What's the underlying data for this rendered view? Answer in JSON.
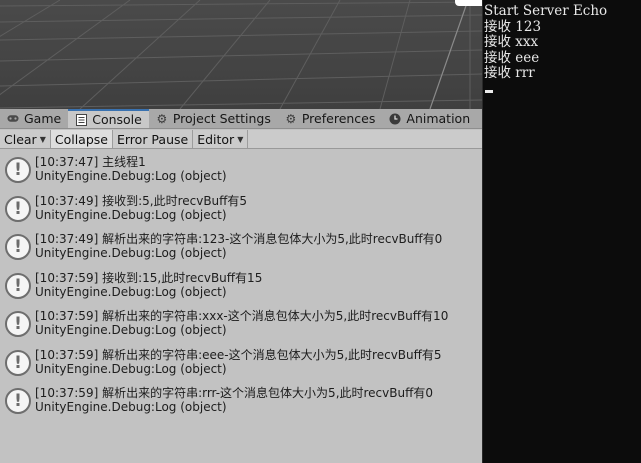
{
  "tabs": [
    {
      "label": "Game",
      "icon": "gamepad-icon",
      "active": false
    },
    {
      "label": "Console",
      "icon": "console-icon",
      "active": true
    },
    {
      "label": "Project Settings",
      "icon": "gear-icon",
      "active": false
    },
    {
      "label": "Preferences",
      "icon": "gear-icon",
      "active": false
    },
    {
      "label": "Animation",
      "icon": "clock-icon",
      "active": false
    }
  ],
  "toolbar": {
    "clear": "Clear",
    "collapse": "Collapse",
    "error_pause": "Error Pause",
    "editor": "Editor"
  },
  "console": {
    "entries": [
      {
        "message": "[10:37:47] 主线程1",
        "source": "UnityEngine.Debug:Log (object)"
      },
      {
        "message": "[10:37:49] 接收到:5,此时recvBuff有5",
        "source": "UnityEngine.Debug:Log (object)"
      },
      {
        "message": "[10:37:49] 解析出来的字符串:123-这个消息包体大小为5,此时recvBuff有0",
        "source": "UnityEngine.Debug:Log (object)"
      },
      {
        "message": "[10:37:59] 接收到:15,此时recvBuff有15",
        "source": "UnityEngine.Debug:Log (object)"
      },
      {
        "message": "[10:37:59] 解析出来的字符串:xxx-这个消息包体大小为5,此时recvBuff有10",
        "source": "UnityEngine.Debug:Log (object)"
      },
      {
        "message": "[10:37:59] 解析出来的字符串:eee-这个消息包体大小为5,此时recvBuff有5",
        "source": "UnityEngine.Debug:Log (object)"
      },
      {
        "message": "[10:37:59] 解析出来的字符串:rrr-这个消息包体大小为5,此时recvBuff有0",
        "source": "UnityEngine.Debug:Log (object)"
      }
    ]
  },
  "terminal": {
    "lines": [
      "Start Server Echo",
      "接收 123",
      "接收 xxx",
      "接收 eee",
      "接收 rrr"
    ]
  },
  "colors": {
    "terminal_bg": "#0c0c0c",
    "panel_bg": "#c2c2c2",
    "active_tab_accent": "#3a72b0"
  }
}
